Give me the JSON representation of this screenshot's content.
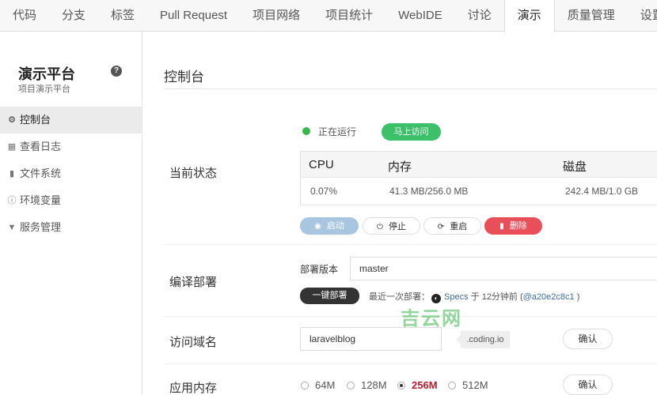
{
  "tabs": [
    "代码",
    "分支",
    "标签",
    "Pull Request",
    "项目网络",
    "项目统计",
    "WebIDE",
    "讨论",
    "演示",
    "质量管理",
    "设置"
  ],
  "sidebar": {
    "title": "演示平台",
    "subtitle": "项目演示平台",
    "help_icon": "?",
    "items": [
      {
        "label": "控制台",
        "icon": "dashboard-icon",
        "glyph": "⚙"
      },
      {
        "label": "查看日志",
        "icon": "calendar-icon",
        "glyph": "▦"
      },
      {
        "label": "文件系统",
        "icon": "file-icon",
        "glyph": "▮"
      },
      {
        "label": "环境变量",
        "icon": "info-icon",
        "glyph": "ⓘ"
      },
      {
        "label": "服务管理",
        "icon": "filter-icon",
        "glyph": "▼"
      }
    ]
  },
  "main": {
    "title": "控制台",
    "status": {
      "label": "当前状态",
      "running_text": "正在运行",
      "visit_button": "马上访问",
      "stats_headers": [
        "CPU",
        "内存",
        "磁盘"
      ],
      "stats_values": [
        "0.07%",
        "41.3 MB/256.0 MB",
        "242.4 MB/1.0 GB"
      ],
      "buttons": {
        "start": "启动",
        "stop": "停止",
        "restart": "重启",
        "delete": "删除"
      },
      "button_glyphs": {
        "start": "◉",
        "stop": "⏻",
        "restart": "⟳",
        "delete": "▮"
      }
    },
    "deploy": {
      "label": "编译部署",
      "version_label": "部署版本",
      "branch_value": "master",
      "deploy_button": "一键部署",
      "last_deploy_prefix": "最近一次部署：",
      "github_glyph": "◐",
      "last_deploy_author": "Specs",
      "last_deploy_mid": "于 12分钟前 (",
      "last_deploy_commit": "@a20e2c8c1",
      "last_deploy_suffix": ")"
    },
    "domain": {
      "label": "访问域名",
      "value": "laravelblog",
      "suffix": ".coding.io",
      "confirm": "确认"
    },
    "memory": {
      "label": "应用内存",
      "options": [
        "64M",
        "128M",
        "256M",
        "512M"
      ],
      "selected": "256M",
      "confirm": "确认"
    },
    "watermark": "吉云网"
  },
  "colors": {
    "running": "#3ab54a",
    "visit": "#3cc06a",
    "delete": "#e94f59",
    "start": "#a9c6e0",
    "selected_memory": "#b71c2c"
  }
}
